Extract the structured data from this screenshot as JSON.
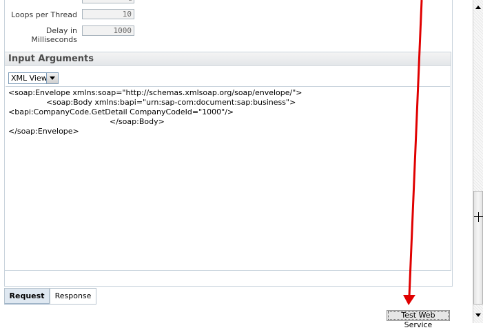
{
  "settings": {
    "loops_label": "Loops per Thread",
    "loops_value": "10",
    "delay_label": "Delay in Milliseconds",
    "delay_value": "1000"
  },
  "input_arguments": {
    "title": "Input Arguments",
    "view_selected": "XML View",
    "xml_lines": [
      "<soap:Envelope xmlns:soap=\"http://schemas.xmlsoap.org/soap/envelope/\">",
      "<soap:Body xmlns:bapi=\"urn:sap-com:document:sap:business\">",
      "<bapi:CompanyCode.GetDetail CompanyCodeId=\"1000\"/>",
      "</soap:Body>",
      "</soap:Envelope>"
    ]
  },
  "tabs": {
    "request": "Request",
    "response": "Response"
  },
  "actions": {
    "test_label": "Test Web Service"
  },
  "annotation": {
    "arrow_color": "#e00000"
  }
}
